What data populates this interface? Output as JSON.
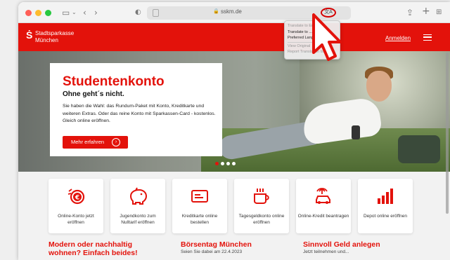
{
  "browser": {
    "url": "sskm.de",
    "icons": [
      "sidebar-icon",
      "chevron-down-icon",
      "back-icon",
      "forward-icon",
      "shield-icon",
      "page-icon",
      "lock-icon",
      "translate-icon",
      "share-icon",
      "new-tab-icon",
      "tabs-overview-icon"
    ],
    "translate_badge": "文A",
    "translate_menu": [
      "Translate to English",
      "Translate to ...",
      "Preferred Languages...",
      "View Original",
      "Report Translation Issue..."
    ]
  },
  "site": {
    "logo_symbol": "Ṡ",
    "logo_line1": "Stadtsparkasse",
    "logo_line2": "München",
    "login_label": "Anmelden",
    "accent_color": "#e3120b"
  },
  "hero": {
    "title": "Studentenkonto",
    "subtitle": "Ohne geht´s nicht.",
    "text": "Sie haben die Wahl: das Rundum-Paket mit Konto, Kreditkarte und weiteren Extras. Oder das reine Konto mit Sparkassen-Card - kostenlos. Gleich online eröffnen.",
    "button_label": "Mehr erfahren",
    "slides": 4,
    "active_slide": 1
  },
  "tiles": [
    {
      "icon": "euro-coin-icon",
      "label": "Online-Konto jetzt eröffnen"
    },
    {
      "icon": "piggy-bank-icon",
      "label": "Jugendkonto zum Nulltarif eröffnen"
    },
    {
      "icon": "credit-card-icon",
      "label": "Kreditkarte online bestellen"
    },
    {
      "icon": "coffee-cup-icon",
      "label": "Tagesgeldkonto online eröffnen"
    },
    {
      "icon": "car-palm-icon",
      "label": "Online-Kredit beantragen"
    },
    {
      "icon": "bar-chart-icon",
      "label": "Depot online eröffnen"
    }
  ],
  "teasers": [
    {
      "title": "Modern oder nachhaltig wohnen? Einfach beides!",
      "sub": ""
    },
    {
      "title": "Börsentag München",
      "sub": "Seien Sie dabei am 22.4.2023"
    },
    {
      "title": "Sinnvoll Geld anlegen",
      "sub": "Jetzt teilnehmen und..."
    }
  ]
}
